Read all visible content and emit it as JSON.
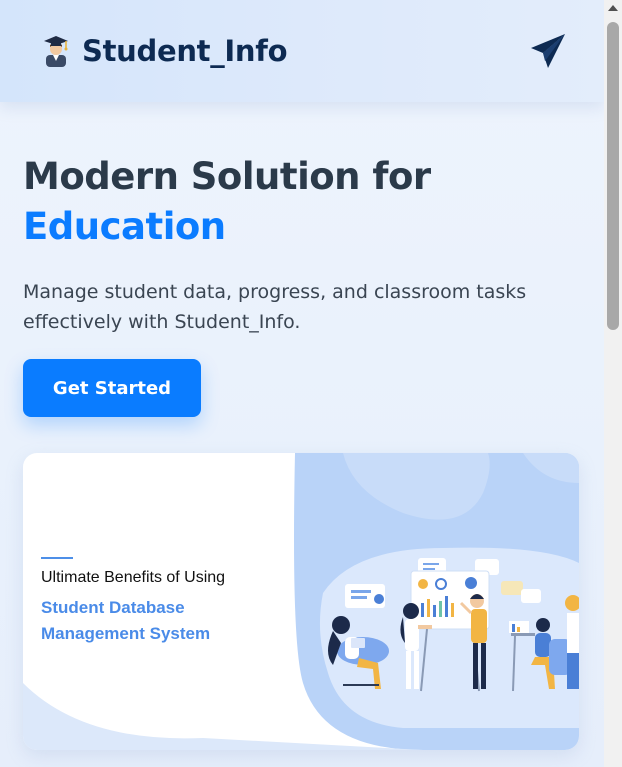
{
  "header": {
    "brand_name": "Student_Info",
    "brand_icon": "graduate-student-icon",
    "send_icon": "paper-plane-icon"
  },
  "hero": {
    "title_line1": "Modern Solution for",
    "title_accent": "Education",
    "subtitle": "Manage student data, progress, and classroom tasks effectively with Student_Info.",
    "cta_label": "Get Started"
  },
  "banner": {
    "line1": "Ultimate Benefits of Using",
    "line2": "Student Database Management System"
  },
  "colors": {
    "accent": "#0b7cff",
    "brand_dark": "#0d2a52",
    "banner_blue": "#4a8be8"
  }
}
